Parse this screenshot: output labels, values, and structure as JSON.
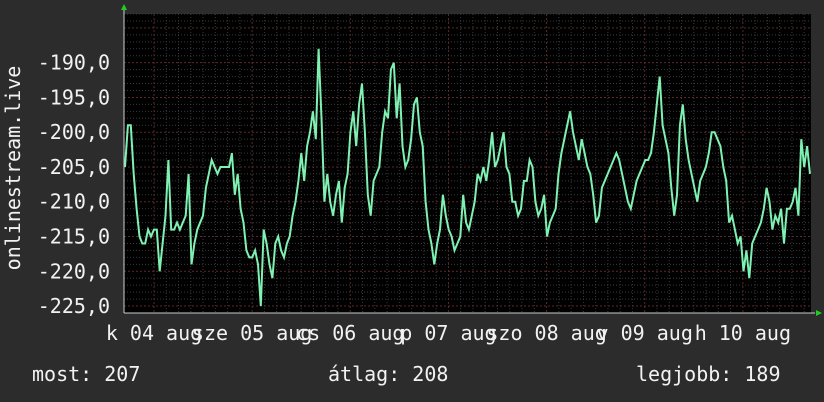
{
  "chart_data": {
    "type": "line",
    "ylabel": "onlinestream.live",
    "ylim": [
      -226,
      -183
    ],
    "yticks": [
      "-190,0",
      "-195,0",
      "-200,0",
      "-205,0",
      "-210,0",
      "-215,0",
      "-220,0",
      "-225,0"
    ],
    "xticks": [
      "k 04 aug",
      "sze 05 aug",
      "cs 06 aug",
      "p 07 aug",
      "szo 08 aug",
      "v 09 aug",
      "h 10 aug"
    ],
    "grid": true,
    "colors": {
      "background": "#000000",
      "line": "#7ff2b3",
      "grid_major": "#5a2a2a",
      "grid_minor": "#3a3a3a",
      "axis": "#cccccc",
      "arrow": "#22cc22"
    },
    "series": [
      {
        "values": [
          -205,
          -199,
          -199,
          -206,
          -211,
          -215,
          -216,
          -216,
          -214,
          -215,
          -214,
          -214,
          -220,
          -216,
          -212,
          -204,
          -214,
          -214,
          -213,
          -214,
          -213,
          -212,
          -206,
          -219,
          -216,
          -214,
          -213,
          -212,
          -208,
          -206,
          -204,
          -205,
          -206,
          -205,
          -205,
          -205,
          -205,
          -203,
          -209,
          -206,
          -211,
          -213,
          -217,
          -218,
          -218,
          -217,
          -219,
          -225,
          -214,
          -216,
          -219,
          -221,
          -216,
          -215,
          -217,
          -218,
          -216,
          -215,
          -212,
          -210,
          -207,
          -203,
          -207,
          -202,
          -200,
          -197,
          -201,
          -188,
          -198,
          -210,
          -206,
          -210,
          -212,
          -209,
          -207,
          -213,
          -208,
          -206,
          -200,
          -197,
          -202,
          -196,
          -193,
          -200,
          -209,
          -212,
          -207,
          -206,
          -205,
          -200,
          -197,
          -198,
          -191,
          -190,
          -198,
          -193,
          -202,
          -205,
          -204,
          -201,
          -196,
          -195,
          -200,
          -202,
          -210,
          -214,
          -216,
          -219,
          -216,
          -214,
          -209,
          -212,
          -214,
          -215,
          -217,
          -216,
          -215,
          -209,
          -213,
          -214,
          -212,
          -210,
          -206,
          -207,
          -205,
          -207,
          -204,
          -200,
          -205,
          -204,
          -202,
          -200,
          -205,
          -206,
          -210,
          -210,
          -212,
          -211,
          -207,
          -207,
          -204,
          -205,
          -210,
          -212,
          -211,
          -209,
          -215,
          -213,
          -212,
          -211,
          -206,
          -203,
          -201,
          -199,
          -197,
          -200,
          -202,
          -204,
          -201,
          -203,
          -205,
          -206,
          -209,
          -213,
          -212,
          -208,
          -207,
          -206,
          -205,
          -204,
          -203,
          -204,
          -206,
          -208,
          -210,
          -211,
          -209,
          -207,
          -206,
          -205,
          -204,
          -204,
          -203,
          -200,
          -196,
          -192,
          -199,
          -201,
          -203,
          -208,
          -212,
          -209,
          -199,
          -196,
          -201,
          -204,
          -206,
          -208,
          -210,
          -207,
          -206,
          -205,
          -203,
          -200,
          -200,
          -201,
          -202,
          -205,
          -207,
          -213,
          -212,
          -214,
          -216,
          -215,
          -220,
          -217,
          -221,
          -216,
          -215,
          -214,
          -213,
          -211,
          -208,
          -210,
          -214,
          -212,
          -213,
          -211,
          -216,
          -211,
          -211,
          -210,
          -208,
          -212,
          -201,
          -205,
          -202,
          -206
        ],
        "color": "#7ff2b3"
      }
    ],
    "stats": [
      {
        "label": "most: 207"
      },
      {
        "label": "átlag: 208"
      },
      {
        "label": "legjobb: 189"
      }
    ]
  }
}
